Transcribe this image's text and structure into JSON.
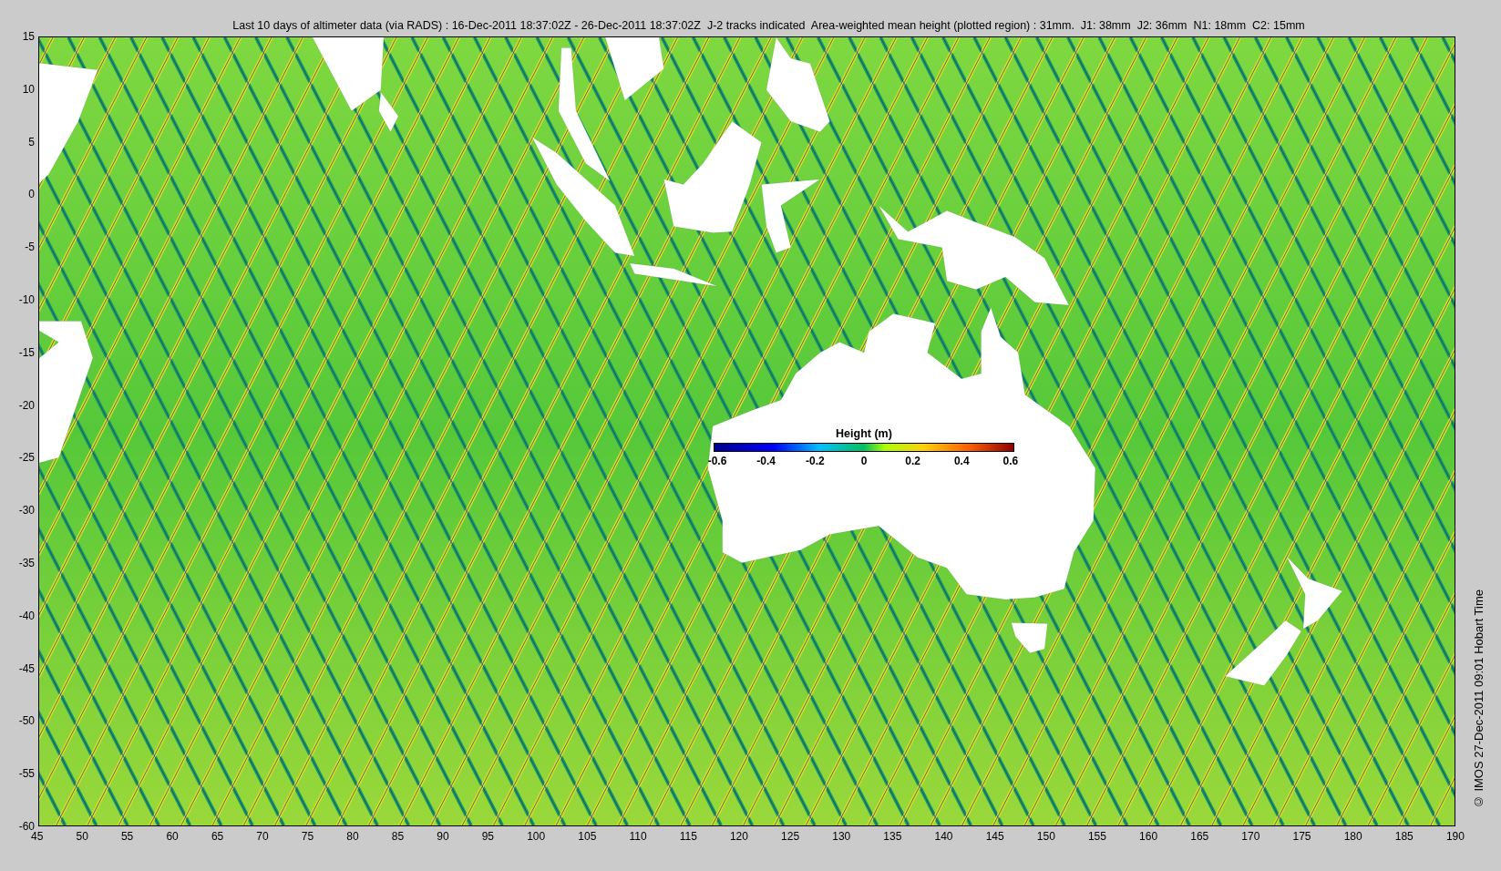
{
  "title": "Last 10 days of altimeter data (via RADS) : 16-Dec-2011 18:37:02Z - 26-Dec-2011 18:37:02Z  J-2 tracks indicated  Area-weighted mean height (plotted region) : 31mm.  J1: 38mm  J2: 36mm  N1: 18mm  C2: 15mm",
  "map": {
    "y_ticks": [
      "15",
      "10",
      "5",
      "0",
      "-5",
      "-10",
      "-15",
      "-20",
      "-25",
      "-30",
      "-35",
      "-40",
      "-45",
      "-50",
      "-55",
      "-60"
    ],
    "x_ticks": [
      "45",
      "50",
      "55",
      "60",
      "65",
      "70",
      "75",
      "80",
      "85",
      "90",
      "95",
      "100",
      "105",
      "110",
      "115",
      "120",
      "125",
      "130",
      "135",
      "140",
      "145",
      "150",
      "155",
      "160",
      "165",
      "170",
      "175",
      "180",
      "185",
      "190"
    ]
  },
  "colorbar": {
    "title": "Height (m)",
    "ticks": [
      "-0.6",
      "-0.4",
      "-0.2",
      "0",
      "0.2",
      "0.4",
      "0.6"
    ]
  },
  "credit": "© IMOS 27-Dec-2011 09:01 Hobart Time"
}
